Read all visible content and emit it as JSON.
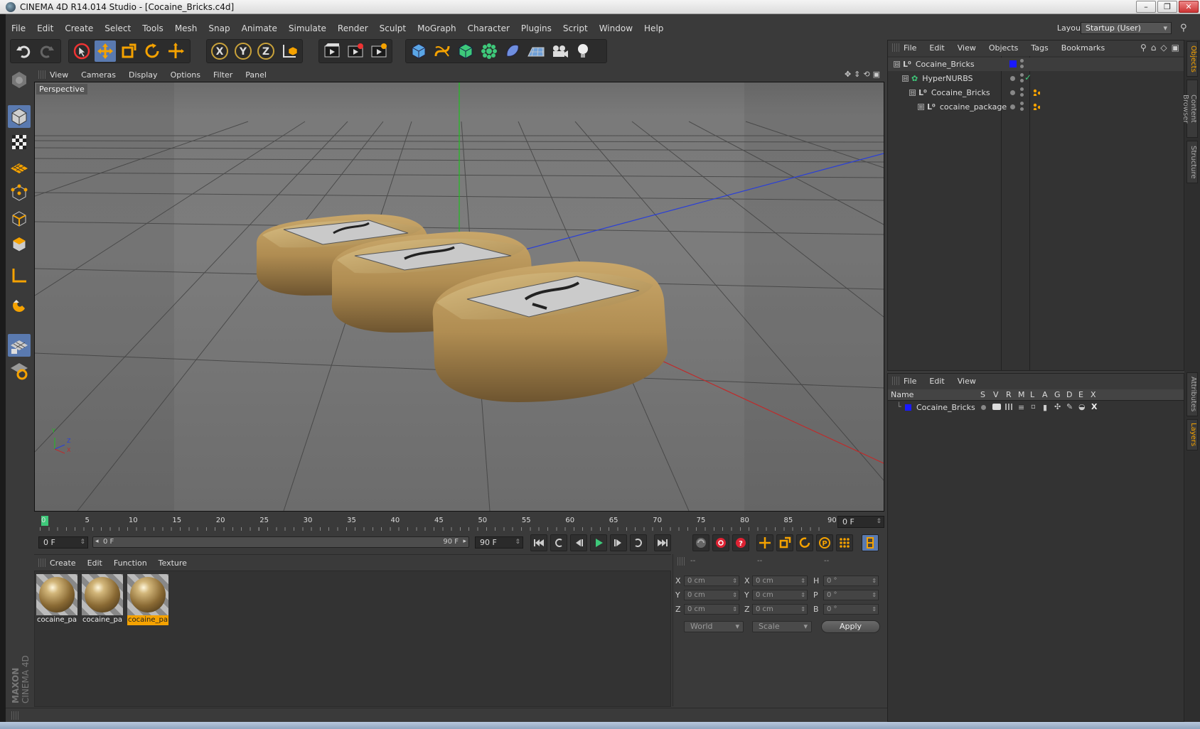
{
  "window": {
    "title": "CINEMA 4D R14.014 Studio - [Cocaine_Bricks.c4d]",
    "buttons": [
      "–",
      "❐",
      "✕"
    ]
  },
  "menubar": {
    "items": [
      "File",
      "Edit",
      "Create",
      "Select",
      "Tools",
      "Mesh",
      "Snap",
      "Animate",
      "Simulate",
      "Render",
      "Sculpt",
      "MoGraph",
      "Character",
      "Plugins",
      "Script",
      "Window",
      "Help"
    ],
    "layout_label": "Layout:",
    "layout_value": "Startup (User)"
  },
  "viewport": {
    "menu": [
      "View",
      "Cameras",
      "Display",
      "Options",
      "Filter",
      "Panel"
    ],
    "label": "Perspective",
    "axis_labels": {
      "y": "Y",
      "z": "Z",
      "x": "X"
    }
  },
  "timeline": {
    "ticks": [
      "0",
      "5",
      "10",
      "15",
      "20",
      "25",
      "30",
      "35",
      "40",
      "45",
      "50",
      "55",
      "60",
      "65",
      "70",
      "75",
      "80",
      "85",
      "90"
    ],
    "current_frame": "0 F",
    "start_field": "0 F",
    "range_start": "0 F",
    "range_end": "90 F",
    "end_field": "90 F"
  },
  "materials": {
    "menu": [
      "Create",
      "Edit",
      "Function",
      "Texture"
    ],
    "items": [
      {
        "name": "cocaine_pa",
        "selected": false
      },
      {
        "name": "cocaine_pa",
        "selected": false
      },
      {
        "name": "cocaine_pa",
        "selected": true
      }
    ]
  },
  "coordinates": {
    "headers": [
      "--",
      "--",
      "--"
    ],
    "rows": [
      {
        "l1": "X",
        "v1": "0 cm",
        "l2": "X",
        "v2": "0 cm",
        "l3": "H",
        "v3": "0 °"
      },
      {
        "l1": "Y",
        "v1": "0 cm",
        "l2": "Y",
        "v2": "0 cm",
        "l3": "P",
        "v3": "0 °"
      },
      {
        "l1": "Z",
        "v1": "0 cm",
        "l2": "Z",
        "v2": "0 cm",
        "l3": "B",
        "v3": "0 °"
      }
    ],
    "mode": "World",
    "transform": "Scale",
    "apply_label": "Apply"
  },
  "object_manager": {
    "menu": [
      "File",
      "Edit",
      "View",
      "Objects",
      "Tags",
      "Bookmarks"
    ],
    "objects": [
      {
        "name": "Cocaine_Bricks",
        "depth": 0,
        "expander": "⊟"
      },
      {
        "name": "HyperNURBS",
        "depth": 1,
        "expander": "⊟"
      },
      {
        "name": "Cocaine_Bricks",
        "depth": 2,
        "expander": "⊟"
      },
      {
        "name": "cocaine_package",
        "depth": 3,
        "expander": "⊞"
      }
    ]
  },
  "layer_manager": {
    "menu": [
      "File",
      "Edit",
      "View"
    ],
    "columns": [
      "Name",
      "S",
      "V",
      "R",
      "M",
      "L",
      "A",
      "G",
      "D",
      "E",
      "X"
    ],
    "layers": [
      {
        "name": "Cocaine_Bricks",
        "color": "#1a1aff"
      }
    ]
  },
  "side_tabs": [
    "Objects",
    "Content Browser",
    "Structure",
    "Attributes",
    "Layers"
  ],
  "brand": {
    "maxon": "MAXON",
    "product": "CINEMA 4D"
  },
  "colors": {
    "accent": "#5a7ab0",
    "selection": "#f5a200",
    "layer": "#1a1aff"
  }
}
